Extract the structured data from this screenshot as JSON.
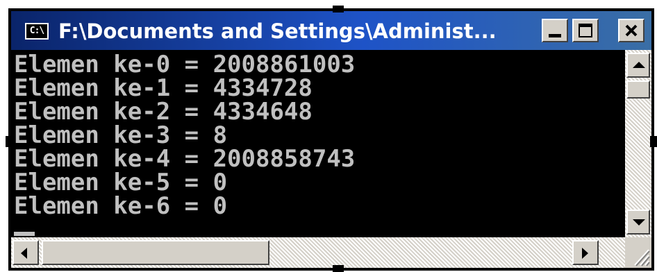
{
  "window": {
    "title": "F:\\Documents and Settings\\Administ...",
    "icon": "cmd-window-icon",
    "icon_text": "C:\\"
  },
  "title_buttons": [
    {
      "name": "minimize",
      "icon": "minimize-icon"
    },
    {
      "name": "maximize",
      "icon": "maximize-icon"
    },
    {
      "name": "close",
      "icon": "close-icon"
    }
  ],
  "console": {
    "lines": [
      "Elemen ke-0 = 2008861003",
      "Elemen ke-1 = 4334728",
      "Elemen ke-2 = 4334648",
      "Elemen ke-3 = 8",
      "Elemen ke-4 = 2008858743",
      "Elemen ke-5 = 0",
      "Elemen ke-6 = 0"
    ],
    "background": "#000000",
    "text_color": "#c0c0c0"
  },
  "scrollbars": {
    "vertical": {
      "up_icon": "arrow-up-icon",
      "down_icon": "arrow-down-icon"
    },
    "horizontal": {
      "left_icon": "arrow-left-icon",
      "right_icon": "arrow-right-icon"
    }
  },
  "colors": {
    "titlebar_start": "#0a246a",
    "titlebar_end": "#3a6ea5",
    "chrome": "#d4d0c8"
  }
}
